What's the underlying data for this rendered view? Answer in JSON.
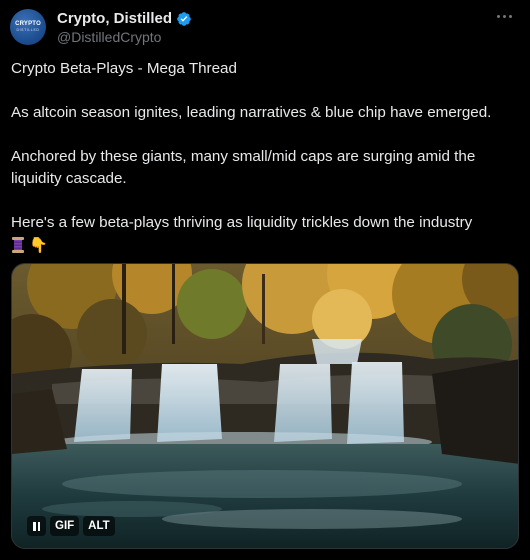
{
  "author": {
    "avatar_top": "CRYPTO",
    "avatar_bottom": "DISTILLED",
    "display_name": "Crypto, Distilled",
    "handle": "@DistilledCrypto",
    "verified": true
  },
  "tweet": {
    "lines": [
      "Crypto Beta-Plays - Mega Thread",
      "As altcoin season ignites, leading narratives & blue chip  have emerged.",
      "Anchored by these giants, many small/mid caps are surging amid the liquidity cascade.",
      "Here's a few beta-plays thriving as liquidity trickles down the industry"
    ],
    "emojis": [
      "thread-spool",
      "pointing-down"
    ]
  },
  "media": {
    "gif_label": "GIF",
    "alt_label": "ALT"
  },
  "colors": {
    "background": "#000000",
    "text": "#e7e9ea",
    "secondary": "#71767b",
    "verified": "#1d9bf0",
    "border": "#2f3336"
  }
}
